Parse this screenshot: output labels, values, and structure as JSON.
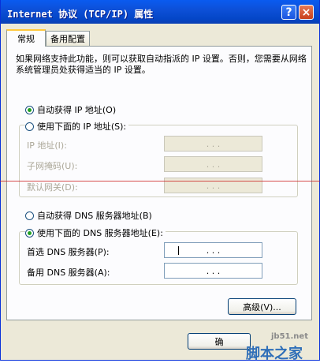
{
  "window": {
    "title": "Internet 协议 (TCP/IP) 属性",
    "help_glyph": "?",
    "close_glyph": "×"
  },
  "tabs": [
    {
      "label": "常规",
      "active": true
    },
    {
      "label": "备用配置",
      "active": false
    }
  ],
  "description": "如果网络支持此功能，则可以获取自动指派的 IP 设置。否则，您需要从网络系统管理员处获得适当的 IP 设置。",
  "ip_section": {
    "auto_label": "自动获得 IP 地址(O)",
    "auto_selected": true,
    "manual_label": "使用下面的 IP 地址(S):",
    "manual_selected": false,
    "fields": [
      {
        "label": "IP 地址(I):",
        "value": ". . ."
      },
      {
        "label": "子网掩码(U):",
        "value": ". . ."
      },
      {
        "label": "默认网关(D):",
        "value": ". . ."
      }
    ]
  },
  "dns_section": {
    "auto_label": "自动获得 DNS 服务器地址(B)",
    "auto_selected": false,
    "manual_label": "使用下面的 DNS 服务器地址(E):",
    "manual_selected": true,
    "fields": [
      {
        "label": "首选 DNS 服务器(P):",
        "value": ". . ."
      },
      {
        "label": "备用 DNS 服务器(A):",
        "value": ". . ."
      }
    ]
  },
  "buttons": {
    "advanced_label": "高级(V)...",
    "ok_label": "确"
  },
  "watermark": {
    "site": "jb51.net",
    "name": "脚本之家"
  }
}
